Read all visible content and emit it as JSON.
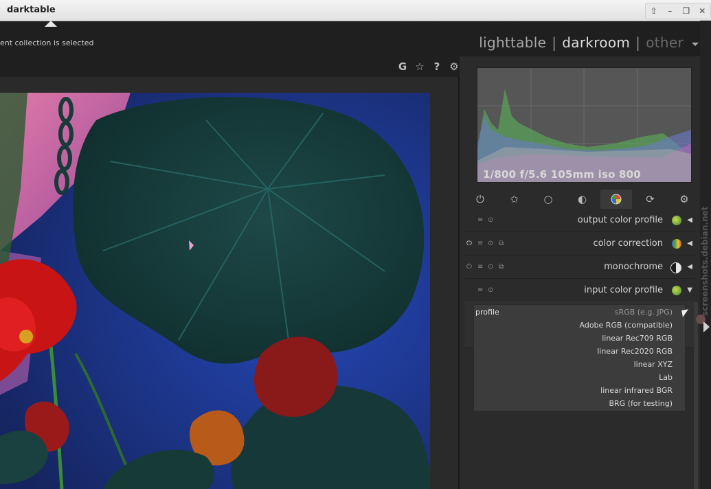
{
  "window": {
    "title": "darktable",
    "controls": [
      "⇧",
      "–",
      "❐",
      "✕"
    ]
  },
  "status": {
    "text": "ent collection is selected"
  },
  "views": {
    "lighttable": "lighttable",
    "darkroom": "darkroom",
    "other": "other",
    "separator": "|"
  },
  "top_tools": [
    {
      "name": "grouping-icon",
      "glyph": "G"
    },
    {
      "name": "star-icon",
      "glyph": "☆"
    },
    {
      "name": "help-icon",
      "glyph": "?"
    },
    {
      "name": "gear-icon",
      "glyph": "⚙"
    }
  ],
  "histogram": {
    "exif": "1/800 f/5.6 105mm iso 800"
  },
  "group_tabs": [
    {
      "name": "power-icon",
      "glyph": "⏻",
      "active": false
    },
    {
      "name": "favorites-star-icon",
      "glyph": "✩",
      "active": false
    },
    {
      "name": "basic-circle-icon",
      "glyph": "○",
      "active": false
    },
    {
      "name": "tone-half-circle-icon",
      "glyph": "◐",
      "active": false
    },
    {
      "name": "color-wheel-icon",
      "glyph": "◉",
      "active": true
    },
    {
      "name": "correct-rotate-icon",
      "glyph": "⟳",
      "active": false
    },
    {
      "name": "effects-aperture-icon",
      "glyph": "⚙",
      "active": false
    }
  ],
  "modules": [
    {
      "label": "output color profile",
      "icon_color": "#9aa544",
      "arrow": "◀",
      "on": false
    },
    {
      "label": "color correction",
      "icon_color": "#7a9a3c",
      "arrow": "◀",
      "on": true
    },
    {
      "label": "monochrome",
      "icon_color": "#e6e6e6",
      "arrow": "◀",
      "on": false
    },
    {
      "label": "input color profile",
      "icon_color": "#9aa544",
      "arrow": "▼",
      "on": false
    }
  ],
  "module_controls": {
    "power": "⏻",
    "presets": "≡",
    "reset": "⊙",
    "instance": "⧉"
  },
  "dropdown": {
    "label": "profile",
    "options": [
      "sRGB (e.g. JPG)",
      "Adobe RGB (compatible)",
      "linear Rec709 RGB",
      "linear Rec2020 RGB",
      "linear XYZ",
      "Lab",
      "linear infrared BGR",
      "BRG (for testing)"
    ],
    "selected_index": 0
  },
  "watermark": "screenshots.debian.net"
}
